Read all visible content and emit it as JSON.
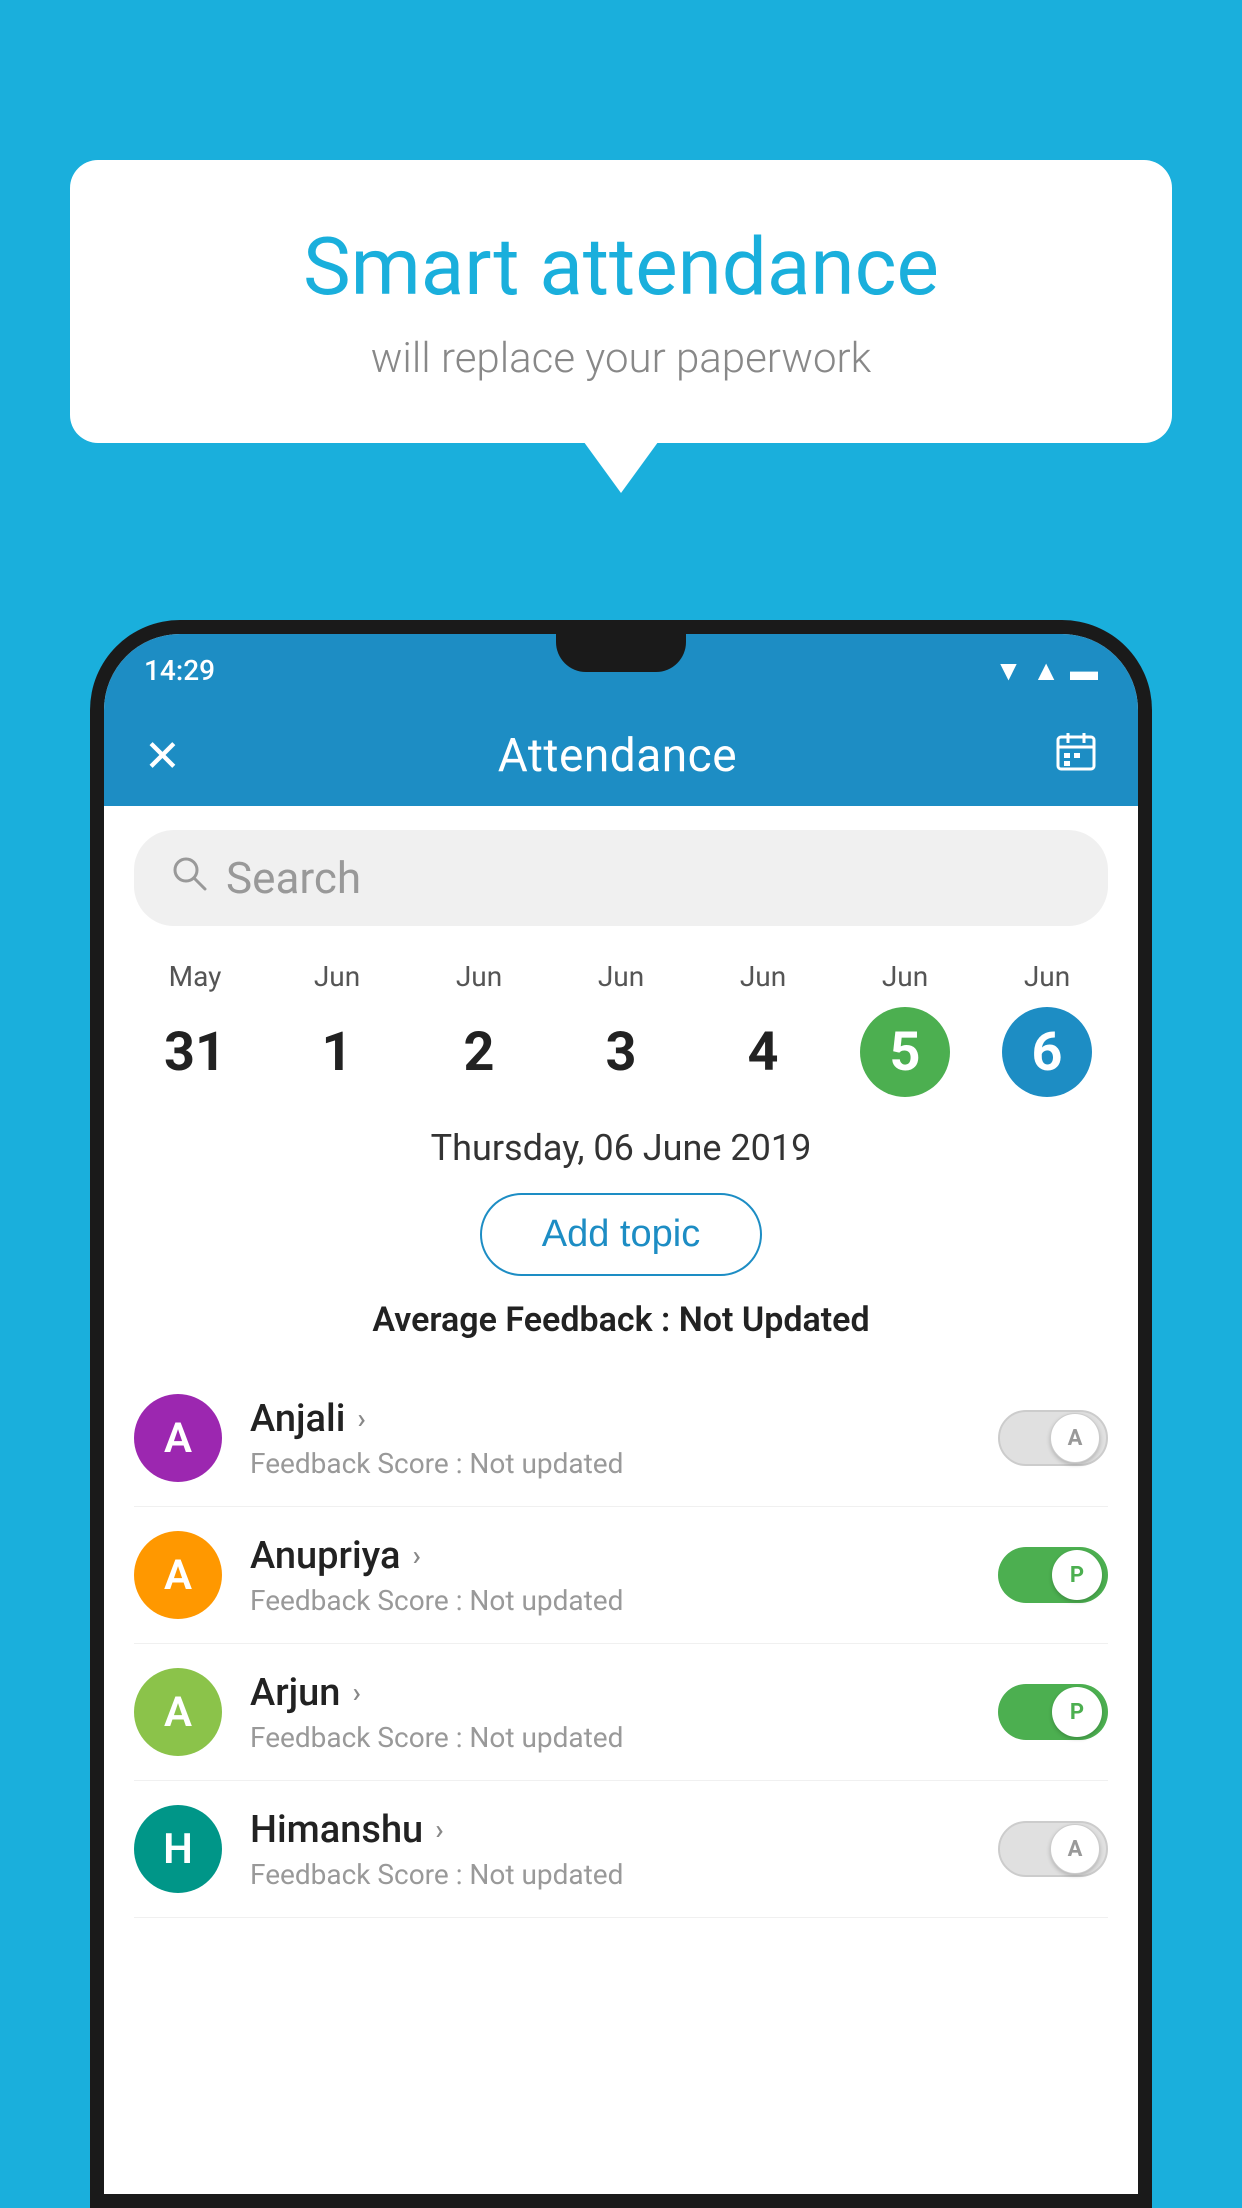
{
  "background_color": "#1AAFDC",
  "speech_bubble": {
    "title": "Smart attendance",
    "subtitle": "will replace your paperwork"
  },
  "phone": {
    "status_bar": {
      "time": "14:29",
      "icons": [
        "wifi",
        "signal",
        "battery"
      ]
    },
    "header": {
      "title": "Attendance",
      "close_label": "×",
      "calendar_icon": "📅"
    },
    "search": {
      "placeholder": "Search"
    },
    "date_scroller": {
      "dates": [
        {
          "month": "May",
          "day": "31",
          "style": "normal"
        },
        {
          "month": "Jun",
          "day": "1",
          "style": "normal"
        },
        {
          "month": "Jun",
          "day": "2",
          "style": "normal"
        },
        {
          "month": "Jun",
          "day": "3",
          "style": "normal"
        },
        {
          "month": "Jun",
          "day": "4",
          "style": "normal"
        },
        {
          "month": "Jun",
          "day": "5",
          "style": "green"
        },
        {
          "month": "Jun",
          "day": "6",
          "style": "blue"
        }
      ]
    },
    "selected_date": "Thursday, 06 June 2019",
    "add_topic_label": "Add topic",
    "avg_feedback": {
      "label": "Average Feedback : ",
      "value": "Not Updated"
    },
    "students": [
      {
        "name": "Anjali",
        "avatar_letter": "A",
        "avatar_color": "purple",
        "feedback": "Feedback Score : Not updated",
        "toggle_state": "off",
        "toggle_label": "A"
      },
      {
        "name": "Anupriya",
        "avatar_letter": "A",
        "avatar_color": "orange",
        "feedback": "Feedback Score : Not updated",
        "toggle_state": "on",
        "toggle_label": "P"
      },
      {
        "name": "Arjun",
        "avatar_letter": "A",
        "avatar_color": "light-green",
        "feedback": "Feedback Score : Not updated",
        "toggle_state": "on",
        "toggle_label": "P"
      },
      {
        "name": "Himanshu",
        "avatar_letter": "H",
        "avatar_color": "teal",
        "feedback": "Feedback Score : Not updated",
        "toggle_state": "off",
        "toggle_label": "A"
      }
    ]
  }
}
